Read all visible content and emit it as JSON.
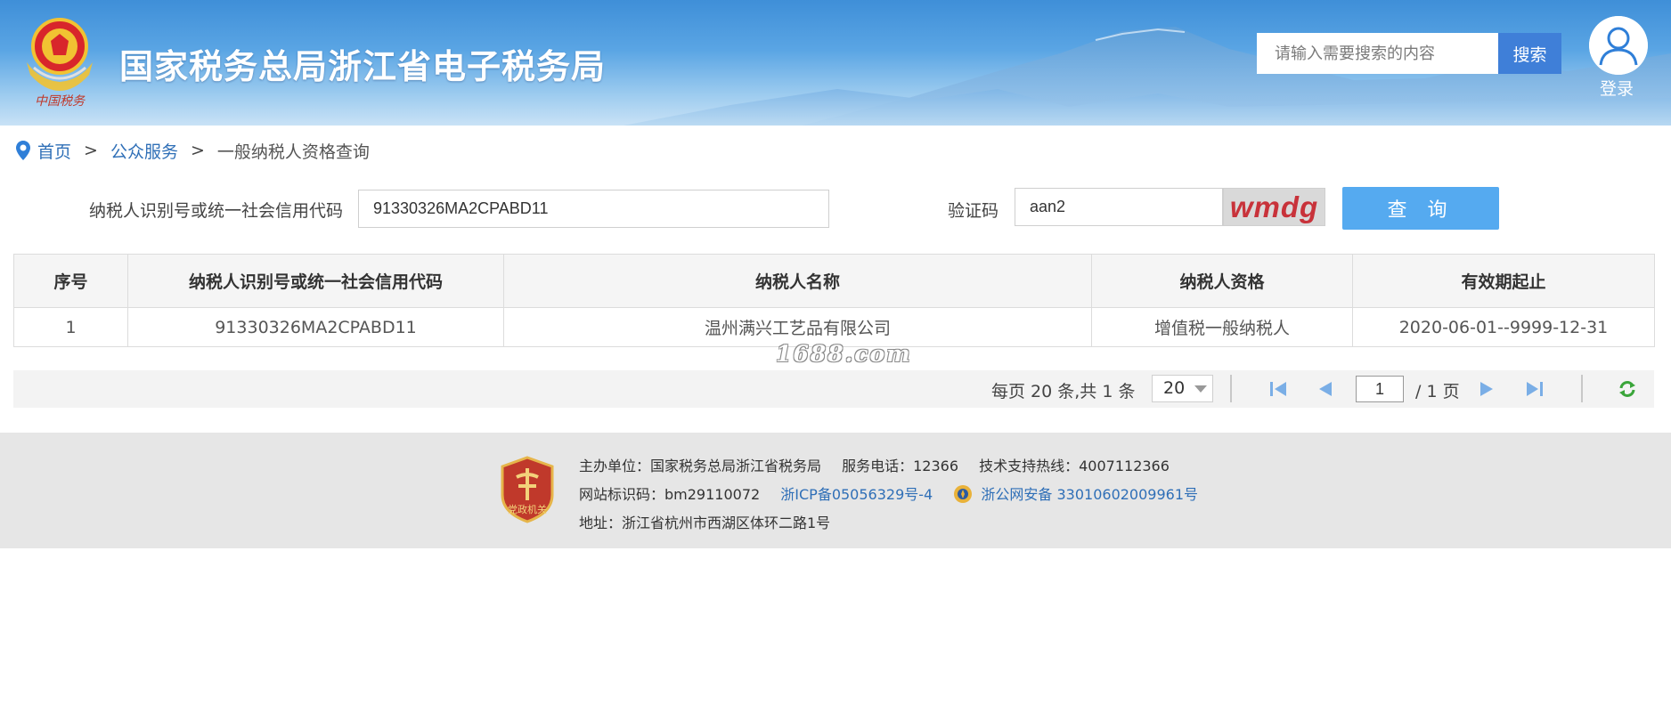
{
  "header": {
    "site_title": "国家税务总局浙江省电子税务局",
    "emblem_text": "中国税务",
    "search_placeholder": "请输入需要搜索的内容",
    "search_button": "搜索",
    "login_label": "登录"
  },
  "breadcrumb": {
    "home": "首页",
    "sep1": ">",
    "public_service": "公众服务",
    "sep2": ">",
    "current": "一般纳税人资格查询"
  },
  "query_form": {
    "code_label": "纳税人识别号或统一社会信用代码",
    "code_value": "91330326MA2CPABD11",
    "captcha_label": "验证码",
    "captcha_value": "aan2",
    "captcha_image_text": "wmdg",
    "query_button": "查 询"
  },
  "table": {
    "headers": [
      "序号",
      "纳税人识别号或统一社会信用代码",
      "纳税人名称",
      "纳税人资格",
      "有效期起止"
    ],
    "rows": [
      [
        "1",
        "91330326MA2CPABD11",
        "温州满兴工艺品有限公司",
        "增值税一般纳税人",
        "2020-06-01--9999-12-31"
      ]
    ]
  },
  "watermark": "1688.com",
  "pagination": {
    "info": "每页 20 条,共 1 条",
    "page_size": "20",
    "current_page": "1",
    "total_pages": "/ 1 页"
  },
  "footer": {
    "sponsor": "主办单位：国家税务总局浙江省税务局",
    "service_phone": "服务电话：12366",
    "support_hotline": "技术支持热线：4007112366",
    "site_id": "网站标识码：bm29110072",
    "icp": "浙ICP备05056329号-4",
    "police_record": "浙公网安备 33010602009961号",
    "address": "地址：浙江省杭州市西湖区体环二路1号",
    "badge_text": "党政机关"
  },
  "colors": {
    "header_blue": "#3f8fd8",
    "search_button": "#3f7fd8",
    "query_button": "#55aaf0",
    "link_blue": "#2f6fb7",
    "footer_bg": "#e6e6e6",
    "captcha_text": "#c8323a",
    "badge_red": "#c0392b"
  },
  "icons": [
    "tax-emblem-icon",
    "avatar-icon",
    "location-pin-icon",
    "first-page-icon",
    "prev-page-icon",
    "next-page-icon",
    "last-page-icon",
    "refresh-icon",
    "party-badge-icon",
    "police-badge-icon"
  ]
}
